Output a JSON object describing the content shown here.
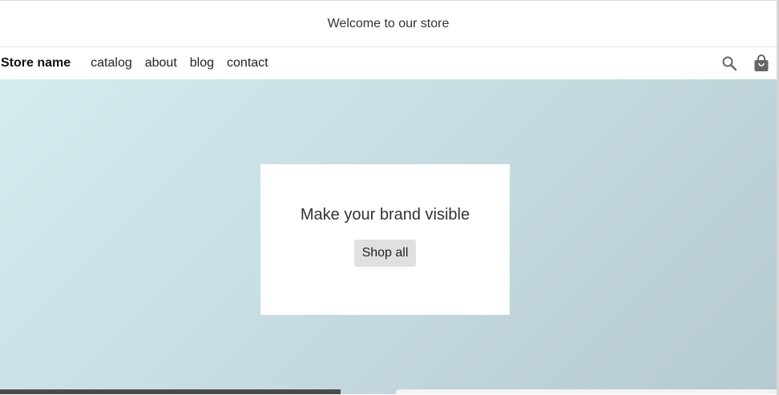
{
  "announcement": {
    "text": "Welcome to our store"
  },
  "header": {
    "store_name": "Store name",
    "nav": [
      {
        "label": "catalog"
      },
      {
        "label": "about"
      },
      {
        "label": "blog"
      },
      {
        "label": "contact"
      }
    ],
    "icons": {
      "search": "search-icon",
      "cart": "shopping-bag-icon"
    }
  },
  "hero": {
    "title": "Make your brand visible",
    "button_label": "Shop all"
  },
  "colors": {
    "hero_gradient_start": "#d6ebee",
    "hero_gradient_end": "#b5c9d0",
    "button_bg": "#e0e0e0",
    "icon_color": "#666666"
  }
}
